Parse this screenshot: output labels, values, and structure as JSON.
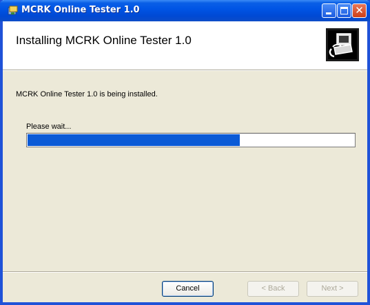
{
  "window": {
    "title": "MCRK Online Tester 1.0",
    "titlebar_color": "#0055E5"
  },
  "titlebar": {
    "app_icon": "installer-icon",
    "controls": [
      "minimize-icon",
      "maximize-icon",
      "close-icon"
    ]
  },
  "banner": {
    "title": "Installing MCRK Online Tester 1.0",
    "graphic_icon": "computer-setup-icon"
  },
  "body": {
    "status": "MCRK Online Tester 1.0 is being installed.",
    "progress_label": "Please wait...",
    "progress_fraction": 0.65,
    "progress_color": "#0A5AD6"
  },
  "buttons": {
    "cancel_label": "Cancel",
    "back_label": "< Back",
    "next_label": "Next >"
  }
}
